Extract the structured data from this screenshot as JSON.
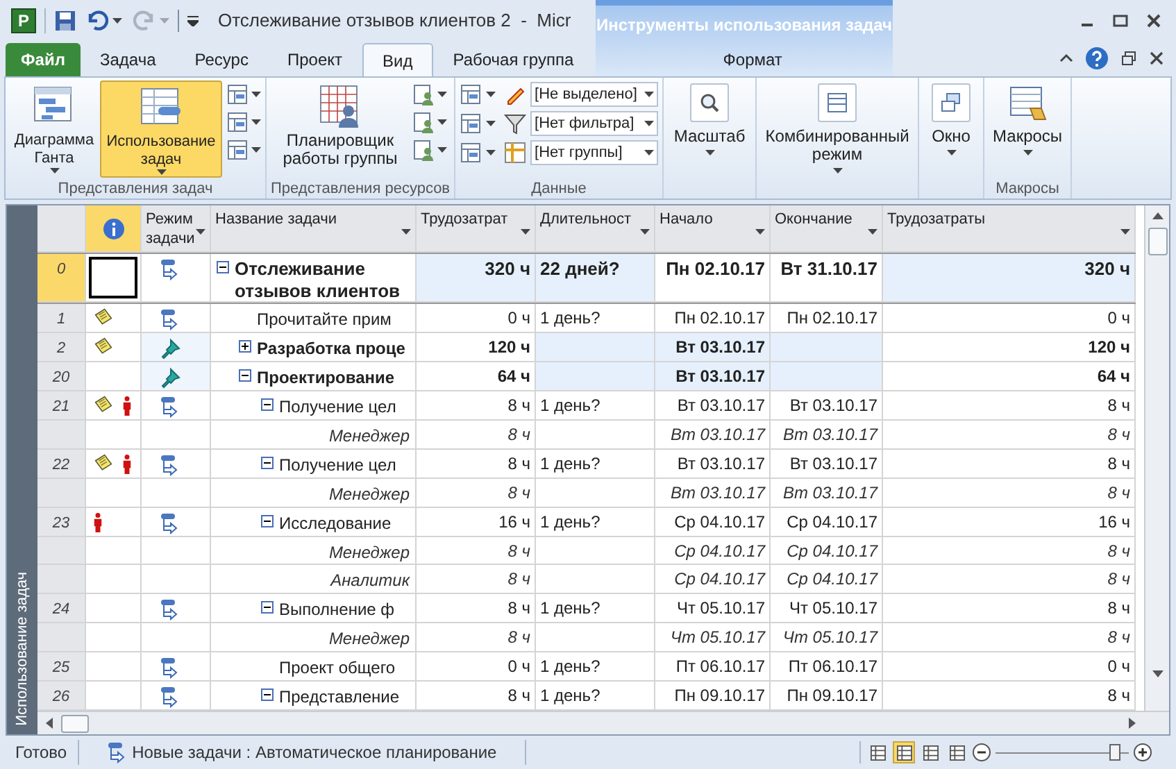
{
  "window": {
    "app_letter": "P",
    "title": "Отслеживание отзывов клиентов 2  -  Micr",
    "context_title": "Инструменты использования задач"
  },
  "tabs": [
    {
      "label": "Файл",
      "kind": "file",
      "selected": false
    },
    {
      "label": "Задача",
      "kind": "tab",
      "selected": false
    },
    {
      "label": "Ресурс",
      "kind": "tab",
      "selected": false
    },
    {
      "label": "Проект",
      "kind": "tab",
      "selected": false
    },
    {
      "label": "Вид",
      "kind": "tab",
      "selected": true
    },
    {
      "label": "Рабочая группа",
      "kind": "tab",
      "selected": false
    },
    {
      "label": "Формат",
      "kind": "context",
      "selected": false
    }
  ],
  "ribbon": {
    "task_views": {
      "label": "Представления задач",
      "gantt": {
        "label": "Диаграмма Ганта",
        "selected": false
      },
      "usage": {
        "label": "Использование задач",
        "selected": true
      }
    },
    "resource_views": {
      "label": "Представления ресурсов",
      "planner": "Планировщик работы группы"
    },
    "data": {
      "label": "Данные",
      "highlight": "[Не выделено]",
      "filter": "[Нет фильтра]",
      "group": "[Нет группы]"
    },
    "zoom": "Масштаб",
    "combined": "Комбинированный режим",
    "window": "Окно",
    "macros": {
      "button": "Макросы",
      "label": "Макросы"
    }
  },
  "side_label": "Использование задач",
  "table": {
    "columns": [
      "Режим задачи",
      "Название задачи",
      "Трудозатрат",
      "Длительност",
      "Начало",
      "Окончание",
      "Трудозатраты"
    ],
    "rows": [
      {
        "id": "0",
        "selected": true,
        "summary": true,
        "manual": false,
        "expanded": true,
        "name": "Отслеживание отзывов клиентов",
        "work": "320 ч",
        "duration": "22 дней?",
        "start": "Пн 02.10.17",
        "finish": "Вт 31.10.17",
        "work_total": "320 ч",
        "children": [
          {
            "id": "1",
            "selected": false,
            "summary": false,
            "manual": false,
            "note": true,
            "person": false,
            "name": "Прочитайте прим",
            "work": "0 ч",
            "duration": "1 день?",
            "start": "Пн 02.10.17",
            "finish": "Пн 02.10.17",
            "work_total": "0 ч"
          },
          {
            "id": "2",
            "selected": false,
            "summary": true,
            "manual": true,
            "note": true,
            "person": false,
            "expanded": false,
            "name": "Разработка проце",
            "work": "120 ч",
            "start": "Вт 03.10.17",
            "work_total": "120 ч"
          },
          {
            "id": "20",
            "selected": false,
            "summary": true,
            "manual": true,
            "note": false,
            "person": false,
            "expanded": true,
            "name": "Проектирование",
            "work": "64 ч",
            "start": "Вт 03.10.17",
            "work_total": "64 ч",
            "children": [
              {
                "id": "21",
                "selected": false,
                "summary": false,
                "manual": false,
                "note": true,
                "person": true,
                "expanded": true,
                "name": "Получение цел",
                "work": "8 ч",
                "duration": "1 день?",
                "start": "Вт 03.10.17",
                "finish": "Вт 03.10.17",
                "work_total": "8 ч",
                "children": [
                  {
                    "kind": "assignment",
                    "name": "Менеджер",
                    "work": "8 ч",
                    "start": "Вт 03.10.17",
                    "finish": "Вт 03.10.17",
                    "work_total": "8 ч"
                  }
                ]
              },
              {
                "id": "22",
                "selected": false,
                "summary": false,
                "manual": false,
                "note": true,
                "person": true,
                "expanded": true,
                "name": "Получение цел",
                "work": "8 ч",
                "duration": "1 день?",
                "start": "Вт 03.10.17",
                "finish": "Вт 03.10.17",
                "work_total": "8 ч",
                "children": [
                  {
                    "kind": "assignment",
                    "name": "Менеджер",
                    "work": "8 ч",
                    "start": "Вт 03.10.17",
                    "finish": "Вт 03.10.17",
                    "work_total": "8 ч"
                  }
                ]
              },
              {
                "id": "23",
                "selected": false,
                "summary": false,
                "manual": false,
                "note": false,
                "person": true,
                "expanded": true,
                "name": "Исследование",
                "work": "16 ч",
                "duration": "1 день?",
                "start": "Ср 04.10.17",
                "finish": "Ср 04.10.17",
                "work_total": "16 ч",
                "children": [
                  {
                    "kind": "assignment",
                    "name": "Менеджер",
                    "work": "8 ч",
                    "start": "Ср 04.10.17",
                    "finish": "Ср 04.10.17",
                    "work_total": "8 ч"
                  },
                  {
                    "kind": "assignment",
                    "name": "Аналитик",
                    "work": "8 ч",
                    "start": "Ср 04.10.17",
                    "finish": "Ср 04.10.17",
                    "work_total": "8 ч"
                  }
                ]
              },
              {
                "id": "24",
                "selected": false,
                "summary": false,
                "manual": false,
                "note": false,
                "person": false,
                "expanded": true,
                "name": "Выполнение ф",
                "work": "8 ч",
                "duration": "1 день?",
                "start": "Чт 05.10.17",
                "finish": "Чт 05.10.17",
                "work_total": "8 ч",
                "children": [
                  {
                    "kind": "assignment",
                    "name": "Менеджер",
                    "work": "8 ч",
                    "start": "Чт 05.10.17",
                    "finish": "Чт 05.10.17",
                    "work_total": "8 ч"
                  }
                ]
              },
              {
                "id": "25",
                "selected": false,
                "summary": false,
                "manual": false,
                "note": false,
                "person": false,
                "name": "Проект общего",
                "work": "0 ч",
                "duration": "1 день?",
                "start": "Пт 06.10.17",
                "finish": "Пт 06.10.17",
                "work_total": "0 ч"
              },
              {
                "id": "26",
                "selected": false,
                "summary": false,
                "manual": false,
                "note": false,
                "person": false,
                "expanded": true,
                "name": "Представление",
                "work": "8 ч",
                "duration": "1 день?",
                "start": "Пн 09.10.17",
                "finish": "Пн 09.10.17",
                "work_total": "8 ч"
              }
            ]
          }
        ]
      }
    ]
  },
  "status_bar": {
    "ready": "Готово",
    "mode": "Новые задачи : Автоматическое планирование",
    "views": [
      {
        "selected": false
      },
      {
        "selected": true
      },
      {
        "selected": false
      },
      {
        "selected": false
      }
    ],
    "zoom": {
      "level": 0.9
    }
  }
}
